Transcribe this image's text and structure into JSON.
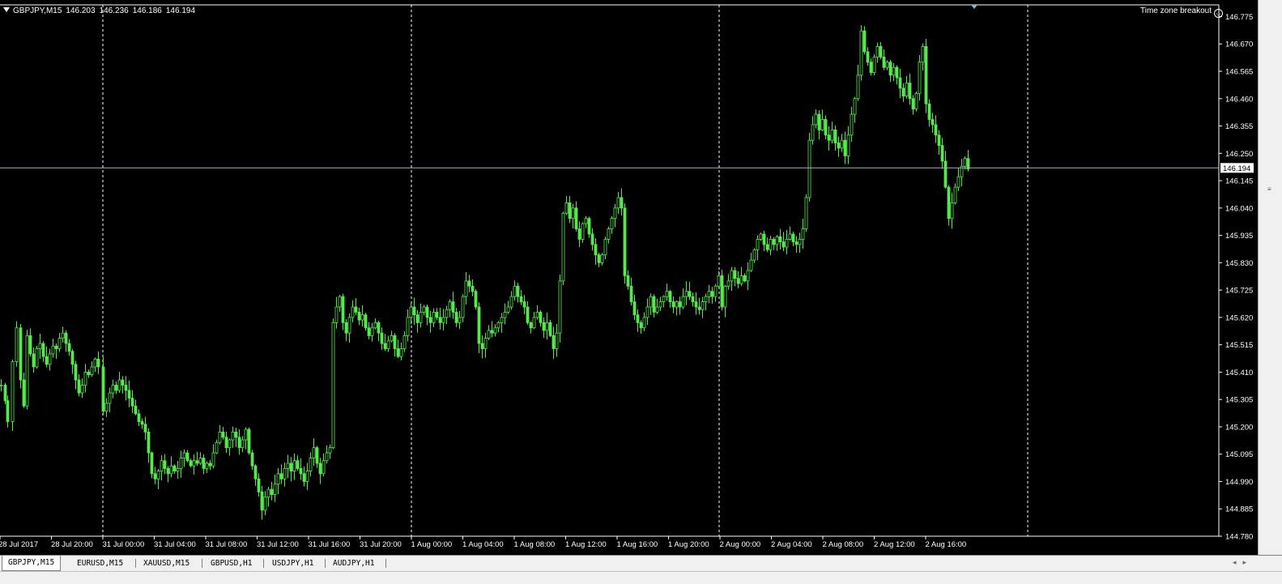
{
  "chart": {
    "symbol": "GBPJPY,M15",
    "ohlc": [
      "146.203",
      "146.236",
      "146.186",
      "146.194"
    ],
    "indicator_label": "Time zone breakout",
    "current_price_label": "146.194"
  },
  "colors": {
    "background": "#000000",
    "candle": "#57e84e",
    "grid": "#ffffff",
    "price_line": "#9fb0c0",
    "axis_text": "#ffffff"
  },
  "chart_data": {
    "type": "candlestick",
    "ylim": [
      144.78,
      146.82
    ],
    "y_ticks": [
      146.775,
      146.67,
      146.565,
      146.46,
      146.355,
      146.25,
      146.145,
      146.04,
      145.935,
      145.83,
      145.725,
      145.62,
      145.515,
      145.41,
      145.305,
      145.2,
      145.095,
      144.99,
      144.885,
      144.78
    ],
    "x_labels": [
      "28 Jul 2017",
      "28 Jul 20:00",
      "31 Jul 00:00",
      "31 Jul 04:00",
      "31 Jul 08:00",
      "31 Jul 12:00",
      "31 Jul 16:00",
      "31 Jul 20:00",
      "1 Aug 00:00",
      "1 Aug 04:00",
      "1 Aug 08:00",
      "1 Aug 12:00",
      "1 Aug 16:00",
      "1 Aug 20:00",
      "2 Aug 00:00",
      "2 Aug 04:00",
      "2 Aug 08:00",
      "2 Aug 12:00",
      "2 Aug 16:00"
    ],
    "day_separators": [
      "31 Jul 00:00",
      "1 Aug 00:00",
      "2 Aug 00:00",
      "3 Aug 00:00"
    ],
    "current_price": 146.194,
    "close_path": [
      [
        0,
        145.36
      ],
      [
        5,
        145.3
      ],
      [
        8,
        145.22
      ],
      [
        14,
        145.45
      ],
      [
        19,
        145.58
      ],
      [
        24,
        145.38
      ],
      [
        28,
        145.28
      ],
      [
        32,
        145.55
      ],
      [
        36,
        145.48
      ],
      [
        40,
        145.43
      ],
      [
        44,
        145.5
      ],
      [
        48,
        145.52
      ],
      [
        52,
        145.47
      ],
      [
        56,
        145.44
      ],
      [
        60,
        145.48
      ],
      [
        64,
        145.51
      ],
      [
        68,
        145.5
      ],
      [
        72,
        145.54
      ],
      [
        76,
        145.56
      ],
      [
        80,
        145.52
      ],
      [
        84,
        145.49
      ],
      [
        88,
        145.44
      ],
      [
        92,
        145.38
      ],
      [
        96,
        145.33
      ],
      [
        100,
        145.36
      ],
      [
        104,
        145.41
      ],
      [
        108,
        145.4
      ],
      [
        112,
        145.43
      ],
      [
        116,
        145.46
      ],
      [
        120,
        145.43
      ],
      [
        126,
        145.26
      ],
      [
        130,
        145.29
      ],
      [
        134,
        145.33
      ],
      [
        138,
        145.36
      ],
      [
        142,
        145.34
      ],
      [
        146,
        145.38
      ],
      [
        150,
        145.36
      ],
      [
        154,
        145.34
      ],
      [
        158,
        145.31
      ],
      [
        162,
        145.28
      ],
      [
        166,
        145.25
      ],
      [
        170,
        145.22
      ],
      [
        174,
        145.21
      ],
      [
        178,
        145.18
      ],
      [
        182,
        145.1
      ],
      [
        186,
        145.02
      ],
      [
        190,
        145.0
      ],
      [
        194,
        145.03
      ],
      [
        198,
        145.07
      ],
      [
        202,
        145.04
      ],
      [
        206,
        145.02
      ],
      [
        210,
        145.05
      ],
      [
        214,
        145.03
      ],
      [
        218,
        145.04
      ],
      [
        222,
        145.08
      ],
      [
        226,
        145.1
      ],
      [
        230,
        145.07
      ],
      [
        234,
        145.05
      ],
      [
        238,
        145.07
      ],
      [
        242,
        145.06
      ],
      [
        246,
        145.08
      ],
      [
        250,
        145.04
      ],
      [
        254,
        145.06
      ],
      [
        258,
        145.05
      ],
      [
        262,
        145.1
      ],
      [
        266,
        145.14
      ],
      [
        270,
        145.18
      ],
      [
        274,
        145.16
      ],
      [
        278,
        145.12
      ],
      [
        282,
        145.15
      ],
      [
        286,
        145.18
      ],
      [
        290,
        145.16
      ],
      [
        294,
        145.12
      ],
      [
        298,
        145.15
      ],
      [
        302,
        145.19
      ],
      [
        306,
        145.1
      ],
      [
        310,
        145.05
      ],
      [
        314,
        145.0
      ],
      [
        318,
        144.95
      ],
      [
        322,
        144.88
      ],
      [
        326,
        144.93
      ],
      [
        330,
        144.96
      ],
      [
        334,
        144.94
      ],
      [
        338,
        144.98
      ],
      [
        342,
        145.02
      ],
      [
        346,
        145.0
      ],
      [
        350,
        145.04
      ],
      [
        354,
        145.06
      ],
      [
        358,
        145.03
      ],
      [
        362,
        145.07
      ],
      [
        366,
        145.04
      ],
      [
        370,
        145.02
      ],
      [
        374,
        144.99
      ],
      [
        378,
        145.03
      ],
      [
        382,
        145.08
      ],
      [
        386,
        145.12
      ],
      [
        390,
        145.06
      ],
      [
        394,
        145.02
      ],
      [
        398,
        145.07
      ],
      [
        402,
        145.1
      ],
      [
        406,
        145.12
      ],
      [
        410,
        145.6
      ],
      [
        414,
        145.66
      ],
      [
        418,
        145.7
      ],
      [
        422,
        145.6
      ],
      [
        426,
        145.56
      ],
      [
        430,
        145.62
      ],
      [
        434,
        145.66
      ],
      [
        438,
        145.64
      ],
      [
        442,
        145.61
      ],
      [
        446,
        145.63
      ],
      [
        450,
        145.58
      ],
      [
        454,
        145.55
      ],
      [
        458,
        145.58
      ],
      [
        462,
        145.6
      ],
      [
        466,
        145.56
      ],
      [
        470,
        145.52
      ],
      [
        474,
        145.5
      ],
      [
        478,
        145.53
      ],
      [
        482,
        145.55
      ],
      [
        486,
        145.5
      ],
      [
        490,
        145.47
      ],
      [
        494,
        145.5
      ],
      [
        498,
        145.55
      ],
      [
        502,
        145.62
      ],
      [
        506,
        145.66
      ],
      [
        510,
        145.63
      ],
      [
        514,
        145.6
      ],
      [
        518,
        145.64
      ],
      [
        522,
        145.66
      ],
      [
        526,
        145.62
      ],
      [
        530,
        145.6
      ],
      [
        534,
        145.64
      ],
      [
        538,
        145.62
      ],
      [
        542,
        145.6
      ],
      [
        546,
        145.62
      ],
      [
        550,
        145.65
      ],
      [
        554,
        145.68
      ],
      [
        558,
        145.64
      ],
      [
        562,
        145.6
      ],
      [
        566,
        145.62
      ],
      [
        570,
        145.7
      ],
      [
        574,
        145.76
      ],
      [
        578,
        145.74
      ],
      [
        582,
        145.72
      ],
      [
        586,
        145.66
      ],
      [
        590,
        145.52
      ],
      [
        594,
        145.5
      ],
      [
        598,
        145.54
      ],
      [
        602,
        145.57
      ],
      [
        606,
        145.56
      ],
      [
        610,
        145.58
      ],
      [
        614,
        145.6
      ],
      [
        618,
        145.62
      ],
      [
        622,
        145.64
      ],
      [
        626,
        145.66
      ],
      [
        630,
        145.7
      ],
      [
        634,
        145.74
      ],
      [
        638,
        145.7
      ],
      [
        642,
        145.68
      ],
      [
        646,
        145.66
      ],
      [
        650,
        145.6
      ],
      [
        654,
        145.58
      ],
      [
        658,
        145.62
      ],
      [
        662,
        145.64
      ],
      [
        666,
        145.6
      ],
      [
        670,
        145.57
      ],
      [
        674,
        145.6
      ],
      [
        678,
        145.55
      ],
      [
        682,
        145.5
      ],
      [
        686,
        145.56
      ],
      [
        690,
        145.76
      ],
      [
        694,
        146.02
      ],
      [
        698,
        146.06
      ],
      [
        702,
        146.0
      ],
      [
        706,
        146.04
      ],
      [
        710,
        145.96
      ],
      [
        714,
        145.92
      ],
      [
        718,
        145.98
      ],
      [
        722,
        146.0
      ],
      [
        726,
        145.94
      ],
      [
        730,
        145.9
      ],
      [
        734,
        145.86
      ],
      [
        738,
        145.83
      ],
      [
        742,
        145.86
      ],
      [
        746,
        145.92
      ],
      [
        750,
        145.96
      ],
      [
        754,
        146.0
      ],
      [
        758,
        146.04
      ],
      [
        762,
        146.08
      ],
      [
        766,
        146.04
      ],
      [
        770,
        145.78
      ],
      [
        774,
        145.74
      ],
      [
        778,
        145.68
      ],
      [
        782,
        145.63
      ],
      [
        786,
        145.6
      ],
      [
        790,
        145.58
      ],
      [
        794,
        145.62
      ],
      [
        798,
        145.66
      ],
      [
        802,
        145.7
      ],
      [
        806,
        145.64
      ],
      [
        810,
        145.66
      ],
      [
        814,
        145.68
      ],
      [
        818,
        145.7
      ],
      [
        822,
        145.72
      ],
      [
        826,
        145.68
      ],
      [
        830,
        145.66
      ],
      [
        834,
        145.68
      ],
      [
        838,
        145.66
      ],
      [
        842,
        145.7
      ],
      [
        846,
        145.72
      ],
      [
        850,
        145.7
      ],
      [
        854,
        145.68
      ],
      [
        858,
        145.66
      ],
      [
        862,
        145.65
      ],
      [
        866,
        145.68
      ],
      [
        870,
        145.7
      ],
      [
        874,
        145.72
      ],
      [
        878,
        145.7
      ],
      [
        882,
        145.74
      ],
      [
        886,
        145.78
      ],
      [
        890,
        145.66
      ],
      [
        894,
        145.74
      ],
      [
        898,
        145.76
      ],
      [
        902,
        145.8
      ],
      [
        906,
        145.77
      ],
      [
        910,
        145.75
      ],
      [
        914,
        145.78
      ],
      [
        918,
        145.76
      ],
      [
        922,
        145.8
      ],
      [
        926,
        145.84
      ],
      [
        930,
        145.88
      ],
      [
        934,
        145.92
      ],
      [
        938,
        145.94
      ],
      [
        942,
        145.9
      ],
      [
        946,
        145.88
      ],
      [
        950,
        145.92
      ],
      [
        954,
        145.9
      ],
      [
        958,
        145.93
      ],
      [
        962,
        145.91
      ],
      [
        966,
        145.89
      ],
      [
        970,
        145.92
      ],
      [
        974,
        145.94
      ],
      [
        978,
        145.91
      ],
      [
        982,
        145.9
      ],
      [
        986,
        145.92
      ],
      [
        990,
        145.96
      ],
      [
        994,
        146.08
      ],
      [
        998,
        146.3
      ],
      [
        1002,
        146.36
      ],
      [
        1006,
        146.4
      ],
      [
        1010,
        146.34
      ],
      [
        1014,
        146.38
      ],
      [
        1018,
        146.32
      ],
      [
        1022,
        146.3
      ],
      [
        1026,
        146.34
      ],
      [
        1030,
        146.29
      ],
      [
        1034,
        146.27
      ],
      [
        1038,
        146.3
      ],
      [
        1042,
        146.24
      ],
      [
        1046,
        146.32
      ],
      [
        1050,
        146.4
      ],
      [
        1054,
        146.46
      ],
      [
        1058,
        146.55
      ],
      [
        1062,
        146.72
      ],
      [
        1066,
        146.64
      ],
      [
        1070,
        146.6
      ],
      [
        1074,
        146.56
      ],
      [
        1078,
        146.62
      ],
      [
        1082,
        146.66
      ],
      [
        1086,
        146.62
      ],
      [
        1090,
        146.58
      ],
      [
        1094,
        146.6
      ],
      [
        1098,
        146.55
      ],
      [
        1102,
        146.58
      ],
      [
        1106,
        146.54
      ],
      [
        1110,
        146.5
      ],
      [
        1114,
        146.47
      ],
      [
        1118,
        146.52
      ],
      [
        1122,
        146.46
      ],
      [
        1126,
        146.42
      ],
      [
        1130,
        146.48
      ],
      [
        1134,
        146.6
      ],
      [
        1138,
        146.66
      ],
      [
        1142,
        146.44
      ],
      [
        1146,
        146.38
      ],
      [
        1150,
        146.36
      ],
      [
        1154,
        146.32
      ],
      [
        1158,
        146.28
      ],
      [
        1162,
        146.22
      ],
      [
        1166,
        146.12
      ],
      [
        1170,
        146.0
      ],
      [
        1174,
        146.06
      ],
      [
        1178,
        146.12
      ],
      [
        1182,
        146.16
      ],
      [
        1186,
        146.2
      ],
      [
        1190,
        146.23
      ],
      [
        1194,
        146.19
      ]
    ]
  },
  "tabs": [
    "GBPJPY,M15",
    "EURUSD,M15",
    "XAUUSD,M15",
    "GBPUSD,H1",
    "USDJPY,H1",
    "AUDJPY,H1"
  ],
  "active_tab": "GBPJPY,M15"
}
